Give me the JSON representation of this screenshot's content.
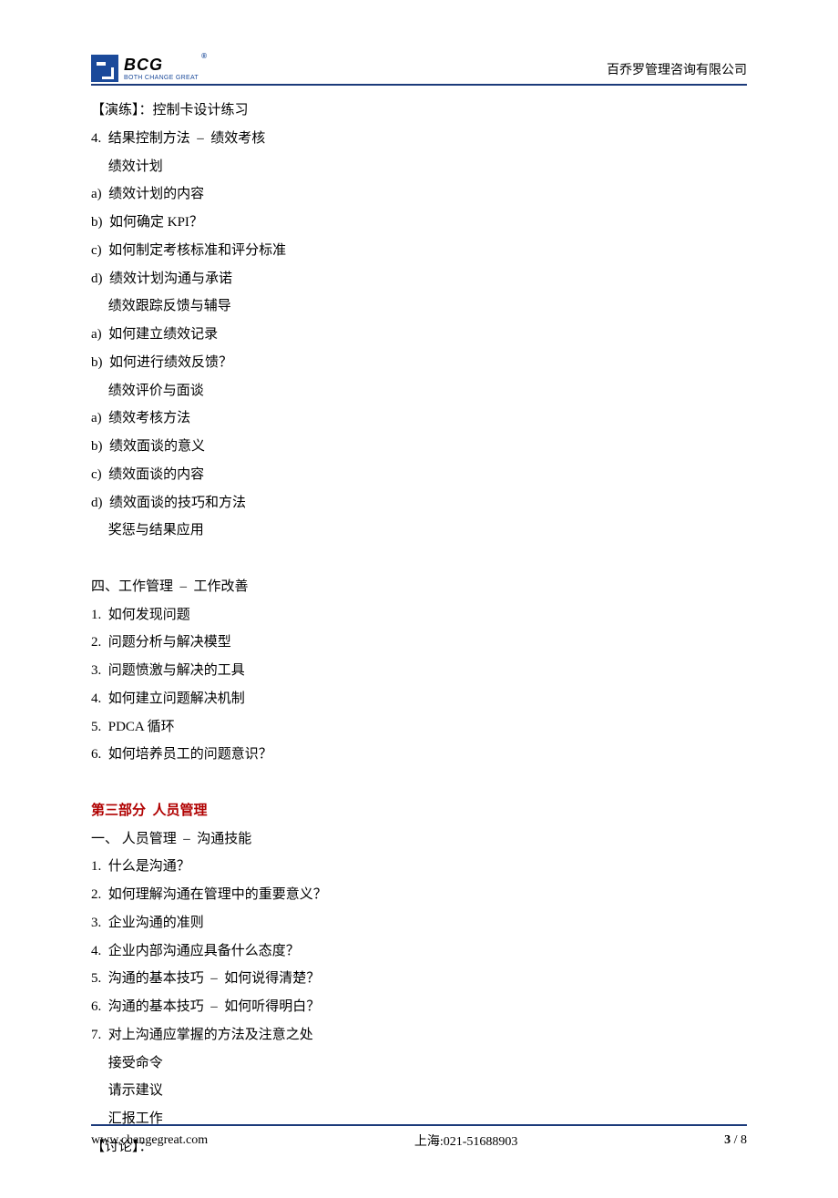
{
  "header": {
    "logo_main": "BCG",
    "logo_sub": "BOTH CHANGE GREAT",
    "company": "百乔罗管理咨询有限公司"
  },
  "body": {
    "lines": [
      {
        "text": "【演练】：控制卡设计练习"
      },
      {
        "text": "4.  结果控制方法  –  绩效考核"
      },
      {
        "text": "     绩效计划"
      },
      {
        "text": "a)  绩效计划的内容"
      },
      {
        "text": "b)  如何确定 KPI？"
      },
      {
        "text": "c)  如何制定考核标准和评分标准"
      },
      {
        "text": "d)  绩效计划沟通与承诺"
      },
      {
        "text": "     绩效跟踪反馈与辅导"
      },
      {
        "text": "a)  如何建立绩效记录"
      },
      {
        "text": "b)  如何进行绩效反馈？"
      },
      {
        "text": "     绩效评价与面谈"
      },
      {
        "text": "a)  绩效考核方法"
      },
      {
        "text": "b)  绩效面谈的意义"
      },
      {
        "text": "c)  绩效面谈的内容"
      },
      {
        "text": "d)  绩效面谈的技巧和方法"
      },
      {
        "text": "     奖惩与结果应用"
      },
      {
        "text": ""
      },
      {
        "text": "四、工作管理  –  工作改善"
      },
      {
        "text": "1.  如何发现问题"
      },
      {
        "text": "2.  问题分析与解决模型"
      },
      {
        "text": "3.  问题愤激与解决的工具"
      },
      {
        "text": "4.  如何建立问题解决机制"
      },
      {
        "text": "5.  PDCA 循环"
      },
      {
        "text": "6.  如何培养员工的问题意识？"
      },
      {
        "text": ""
      },
      {
        "text": "第三部分  人员管理",
        "bold": true,
        "red": true
      },
      {
        "text": "一、 人员管理  –  沟通技能"
      },
      {
        "text": "1.  什么是沟通？"
      },
      {
        "text": "2.  如何理解沟通在管理中的重要意义？"
      },
      {
        "text": "3.  企业沟通的准则"
      },
      {
        "text": "4.  企业内部沟通应具备什么态度？"
      },
      {
        "text": "5.  沟通的基本技巧  –  如何说得清楚？"
      },
      {
        "text": "6.  沟通的基本技巧  –  如何听得明白？"
      },
      {
        "text": "7.  对上沟通应掌握的方法及注意之处"
      },
      {
        "text": "     接受命令"
      },
      {
        "text": "     请示建议"
      },
      {
        "text": "     汇报工作"
      },
      {
        "text": "【讨论】："
      }
    ]
  },
  "footer": {
    "website": "www.changegreat.com",
    "contact": "上海:021-51688903",
    "page_current": "3",
    "page_sep": " / ",
    "page_total": "8"
  }
}
